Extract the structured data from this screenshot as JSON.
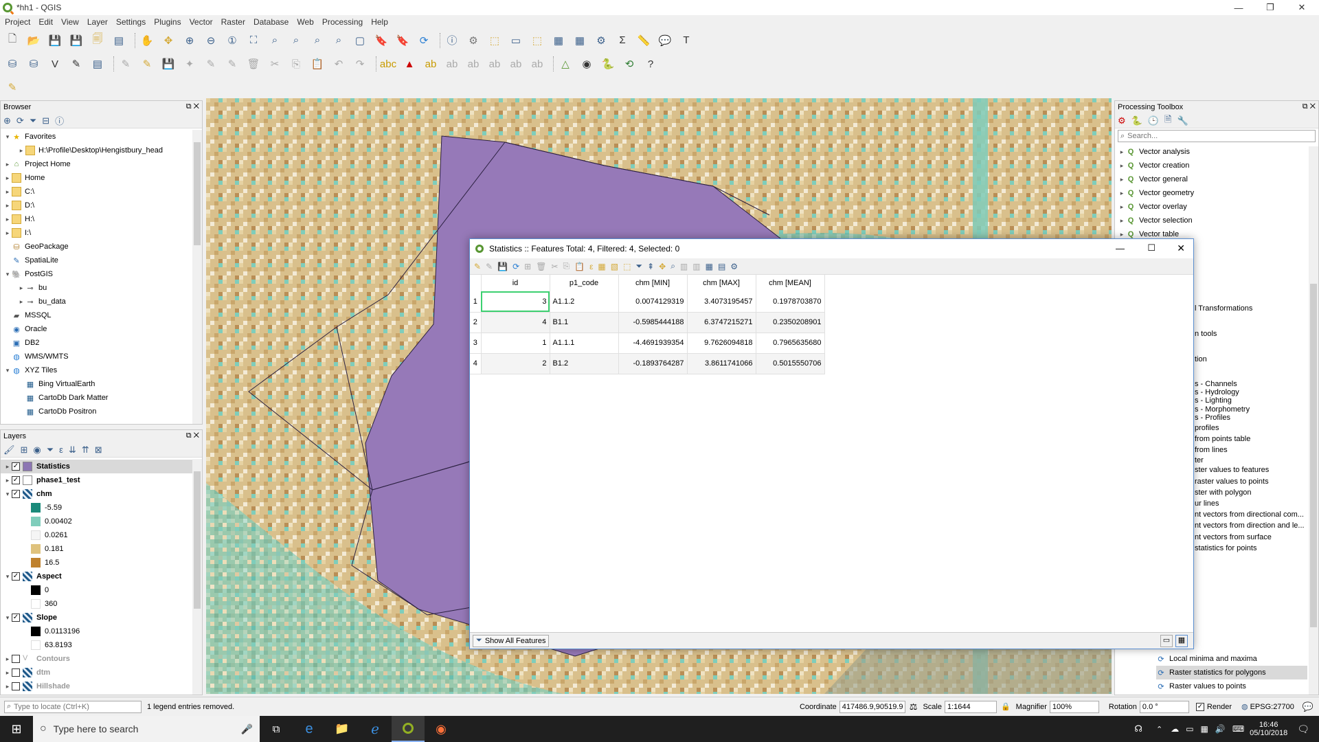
{
  "window": {
    "title": "*hh1 - QGIS",
    "minimize": "—",
    "maximize": "❐",
    "close": "✕"
  },
  "menu": [
    "Project",
    "Edit",
    "View",
    "Layer",
    "Settings",
    "Plugins",
    "Vector",
    "Raster",
    "Database",
    "Web",
    "Processing",
    "Help"
  ],
  "browser": {
    "title": "Browser",
    "items": [
      {
        "label": "Favorites",
        "level": 0,
        "arrow": "▾",
        "icon": "star-icon"
      },
      {
        "label": "H:\\Profile\\Desktop\\Hengistbury_head",
        "level": 1,
        "arrow": "▸",
        "icon": "folder-icon"
      },
      {
        "label": "Project Home",
        "level": 0,
        "arrow": "▸",
        "icon": "project-home-icon"
      },
      {
        "label": "Home",
        "level": 0,
        "arrow": "▸",
        "icon": "folder-icon"
      },
      {
        "label": "C:\\",
        "level": 0,
        "arrow": "▸",
        "icon": "folder-icon"
      },
      {
        "label": "D:\\",
        "level": 0,
        "arrow": "▸",
        "icon": "folder-icon"
      },
      {
        "label": "H:\\",
        "level": 0,
        "arrow": "▸",
        "icon": "folder-icon"
      },
      {
        "label": "I:\\",
        "level": 0,
        "arrow": "▸",
        "icon": "folder-icon"
      },
      {
        "label": "GeoPackage",
        "level": 0,
        "arrow": "",
        "icon": "geopackage-icon"
      },
      {
        "label": "SpatiaLite",
        "level": 0,
        "arrow": "",
        "icon": "spatialite-icon"
      },
      {
        "label": "PostGIS",
        "level": 0,
        "arrow": "▾",
        "icon": "postgis-icon"
      },
      {
        "label": "bu",
        "level": 1,
        "arrow": "▸",
        "icon": "connection-icon"
      },
      {
        "label": "bu_data",
        "level": 1,
        "arrow": "▸",
        "icon": "connection-icon"
      },
      {
        "label": "MSSQL",
        "level": 0,
        "arrow": "",
        "icon": "mssql-icon"
      },
      {
        "label": "Oracle",
        "level": 0,
        "arrow": "",
        "icon": "oracle-icon"
      },
      {
        "label": "DB2",
        "level": 0,
        "arrow": "",
        "icon": "db2-icon"
      },
      {
        "label": "WMS/WMTS",
        "level": 0,
        "arrow": "",
        "icon": "wms-icon"
      },
      {
        "label": "XYZ Tiles",
        "level": 0,
        "arrow": "▾",
        "icon": "xyz-icon"
      },
      {
        "label": "Bing VirtualEarth",
        "level": 1,
        "arrow": "",
        "icon": "tile-icon"
      },
      {
        "label": "CartoDb Dark Matter",
        "level": 1,
        "arrow": "",
        "icon": "tile-icon"
      },
      {
        "label": "CartoDb Positron",
        "level": 1,
        "arrow": "",
        "icon": "tile-icon"
      }
    ]
  },
  "layers": {
    "title": "Layers",
    "items": [
      {
        "label": "Statistics",
        "kind": "layer",
        "checked": true,
        "bold": true,
        "selected": true,
        "swatch": "#8c76b3"
      },
      {
        "label": "phase1_test",
        "kind": "layer",
        "checked": true,
        "bold": true,
        "swatch": "#ffffff"
      },
      {
        "label": "chm",
        "kind": "layer",
        "checked": true,
        "bold": true,
        "expanded": true,
        "swatch": "raster"
      },
      {
        "label": "-5.59",
        "kind": "legend",
        "swatch": "#1a8a7a"
      },
      {
        "label": "0.00402",
        "kind": "legend",
        "swatch": "#7fcdbb"
      },
      {
        "label": "0.0261",
        "kind": "legend",
        "swatch": "#f5f5f5"
      },
      {
        "label": "0.181",
        "kind": "legend",
        "swatch": "#dfc27d"
      },
      {
        "label": "16.5",
        "kind": "legend",
        "swatch": "#bf812d"
      },
      {
        "label": "Aspect",
        "kind": "layer",
        "checked": true,
        "bold": true,
        "expanded": true,
        "swatch": "raster"
      },
      {
        "label": "0",
        "kind": "legend",
        "swatch": "#000000"
      },
      {
        "label": "360",
        "kind": "legend",
        "swatch": "#ffffff"
      },
      {
        "label": "Slope",
        "kind": "layer",
        "checked": true,
        "bold": true,
        "expanded": true,
        "swatch": "raster"
      },
      {
        "label": "0.0113196",
        "kind": "legend",
        "swatch": "#000000"
      },
      {
        "label": "63.8193",
        "kind": "legend",
        "swatch": "#ffffff"
      },
      {
        "label": "Contours",
        "kind": "layer",
        "checked": false,
        "bold": true,
        "grey": true,
        "swatch": "line"
      },
      {
        "label": "dtm",
        "kind": "layer",
        "checked": false,
        "bold": true,
        "grey": true,
        "swatch": "raster"
      },
      {
        "label": "Hillshade",
        "kind": "layer",
        "checked": false,
        "bold": true,
        "grey": true,
        "swatch": "raster"
      }
    ]
  },
  "toolbox": {
    "title": "Processing Toolbox",
    "search_placeholder": "Search...",
    "groups": [
      "Vector analysis",
      "Vector creation",
      "Vector general",
      "Vector geometry",
      "Vector overlay",
      "Vector selection",
      "Vector table"
    ],
    "partial": [
      "l Transformations",
      "n tools",
      "tion",
      "s - Channels",
      "s - Hydrology",
      "s - Lighting",
      "s - Morphometry",
      "s - Profiles",
      "profiles",
      "from points table",
      "from lines",
      "ter",
      "ster values to features",
      "raster values to points",
      "ster with polygon",
      "ur lines",
      "nt vectors from directional com...",
      "nt vectors from direction and le...",
      "nt vectors from surface",
      "statistics for points"
    ],
    "tools": [
      "Local minima and maxima",
      "Raster statistics for polygons",
      "Raster values to points"
    ]
  },
  "attr_table": {
    "title": "Statistics :: Features Total: 4, Filtered: 4, Selected: 0",
    "columns": [
      "id",
      "p1_code",
      "chm [MIN]",
      "chm [MAX]",
      "chm [MEAN]"
    ],
    "rows": [
      {
        "n": "1",
        "cells": [
          "3",
          "A1.1.2",
          "0.0074129319",
          "3.4073195457",
          "0.1978703870"
        ]
      },
      {
        "n": "2",
        "cells": [
          "4",
          "B1.1",
          "-0.5985444188",
          "6.3747215271",
          "0.2350208901"
        ]
      },
      {
        "n": "3",
        "cells": [
          "1",
          "A1.1.1",
          "-4.4691939354",
          "9.7626094818",
          "0.7965635680"
        ]
      },
      {
        "n": "4",
        "cells": [
          "2",
          "B1.2",
          "-0.1893764287",
          "3.8611741066",
          "0.5015550706"
        ]
      }
    ],
    "show_all_label": "Show All Features"
  },
  "statusbar": {
    "locate_placeholder": "Type to locate (Ctrl+K)",
    "message": "1 legend entries removed.",
    "coordinate_label": "Coordinate",
    "coordinate_value": "417486.9,90519.9",
    "scale_label": "Scale",
    "scale_value": "1:1644",
    "magnifier_label": "Magnifier",
    "magnifier_value": "100%",
    "rotation_label": "Rotation",
    "rotation_value": "0.0 °",
    "render_label": "Render",
    "crs_label": "EPSG:27700"
  },
  "taskbar": {
    "search_placeholder": "Type here to search",
    "time": "16:46",
    "date": "05/10/2018"
  },
  "colors": {
    "polygon": "#8c76b3",
    "accent": "#5a8ed0",
    "raster_sand": "#d9c08c",
    "raster_teal": "#7fcdbb"
  }
}
